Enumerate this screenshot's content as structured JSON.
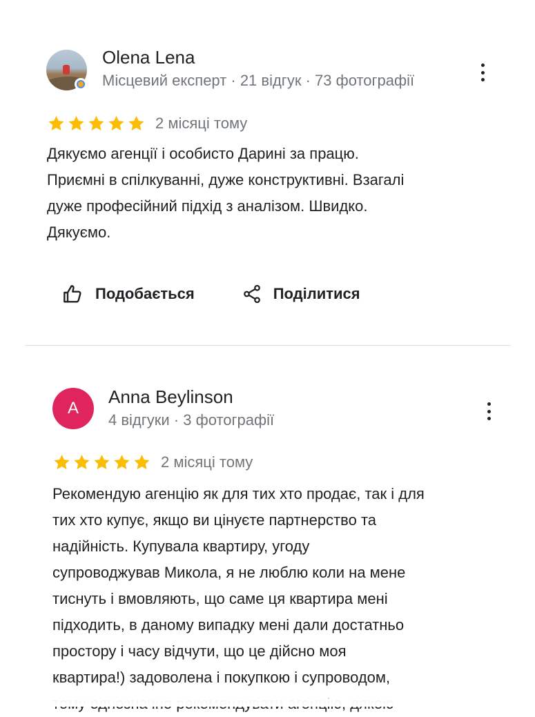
{
  "reviews": [
    {
      "author": "Olena Lena",
      "meta": "Місцевий експерт · 21 відгук · 73 фотографії",
      "rating": 5,
      "rating_max": 5,
      "relative_time": "2 місяці тому",
      "text_lines": [
        "Дякуємо агенції і особисто Дарині за працю.",
        "Приємні в спілкуванні, дуже конструктивні. Взагалі",
        "дуже професійний підхід з аналізом. Швидко.",
        "Дякуємо."
      ],
      "actions": {
        "like_label": "Подобається",
        "share_label": "Поділитися"
      },
      "avatar": {
        "type": "photo",
        "badge": "local-guide-badge-icon"
      }
    },
    {
      "author": "Anna Beylinson",
      "meta": "4 відгуки · 3 фотографії",
      "rating": 5,
      "rating_max": 5,
      "relative_time": "2 місяці тому",
      "text_lines": [
        "Рекомендую агенцію як для тих хто продає, так і для",
        "тих хто купує, якщо ви цінуєте партнерство та",
        "надійність. Купувала квартиру, угоду",
        "супроводжував Микола, я не люблю коли на мене",
        "тиснуть і вмовляють, що саме ця квартира мені",
        "підходить, в даному випадку мені дали достатньо",
        "простору і часу відчути, що це дійсно моя",
        "квартира!) задоволена і покупкою і супроводом,",
        "тому однозначно рекомендувати агенцію, дякою"
      ],
      "avatar": {
        "type": "letter",
        "letter": "A",
        "color": "#e0245e"
      }
    }
  ],
  "colors": {
    "star": "#fbbc04",
    "text_primary": "#202124",
    "text_secondary": "#70757a",
    "divider": "#dadce0"
  },
  "icons": {
    "like": "thumb-up-icon",
    "share": "share-icon",
    "more": "more-vert-icon",
    "star": "star-icon"
  }
}
